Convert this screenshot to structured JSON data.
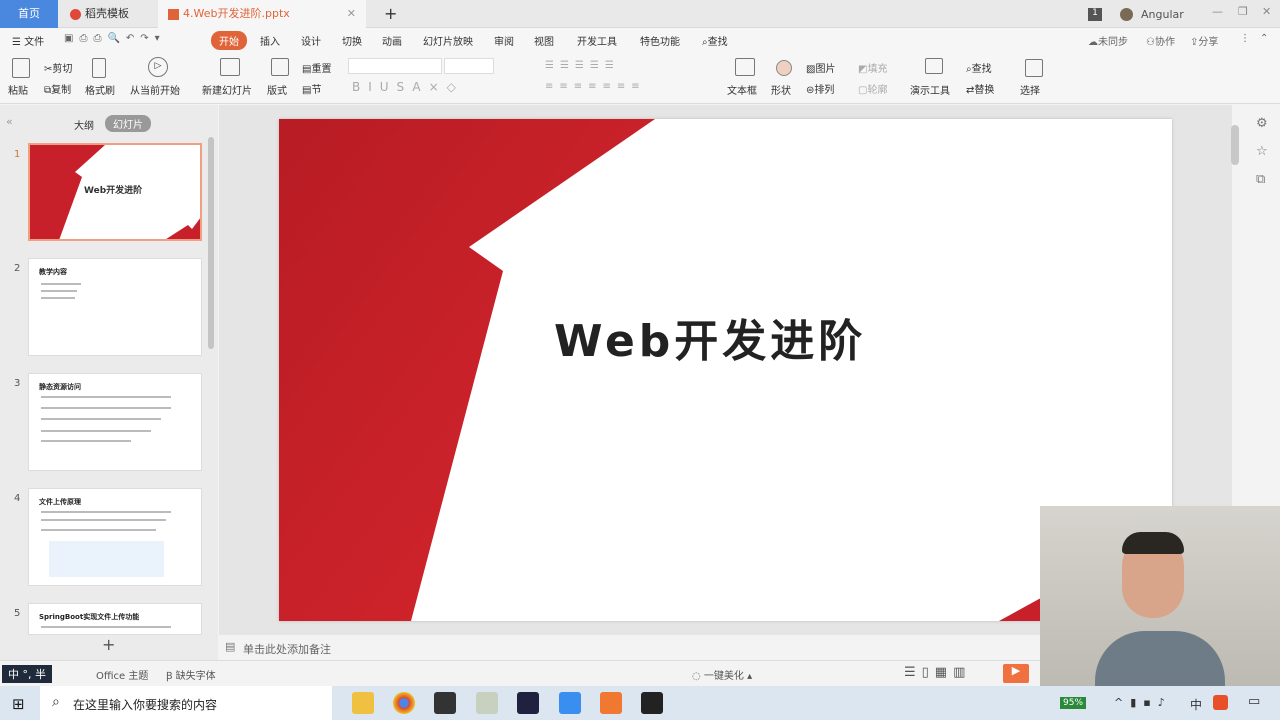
{
  "tabs": [
    {
      "label": "首页"
    },
    {
      "label": "稻壳模板"
    },
    {
      "label": "4.Web开发进阶.pptx"
    }
  ],
  "window": {
    "badge": "1",
    "user": "Angular"
  },
  "menu": {
    "file": "文件",
    "items": [
      "开始",
      "插入",
      "设计",
      "切换",
      "动画",
      "幻灯片放映",
      "审阅",
      "视图",
      "开发工具",
      "特色功能"
    ],
    "search": "查找",
    "sync": "未同步",
    "collab": "协作",
    "share": "分享"
  },
  "ribbon": {
    "paste": "粘贴",
    "cut": "剪切",
    "copy": "复制",
    "format_painter": "格式刷",
    "play_from_current": "从当前开始",
    "new_slide": "新建幻灯片",
    "layout": "版式",
    "reset": "重置",
    "section": "节",
    "textbox": "文本框",
    "shape": "形状",
    "picture": "图片",
    "fill": "填充",
    "arrange": "排列",
    "outline": "轮廓",
    "present_tools": "演示工具",
    "find": "查找",
    "replace": "替换",
    "select": "选择"
  },
  "left_panel": {
    "tab_outline": "大纲",
    "tab_slides": "幻灯片"
  },
  "slides": [
    {
      "num": "1",
      "title": "Web开发进阶"
    },
    {
      "num": "2",
      "title": "教学内容"
    },
    {
      "num": "3",
      "title": "静态资源访问"
    },
    {
      "num": "4",
      "title": "文件上传原理"
    },
    {
      "num": "5",
      "title": "SpringBoot实现文件上传功能"
    }
  ],
  "main_slide": {
    "title": "Web开发进阶"
  },
  "notes": {
    "placeholder": "单击此处添加备注"
  },
  "status": {
    "theme": "Office 主题",
    "missing_fonts": "缺失字体",
    "beautify": "一键美化",
    "ime": "中 °, 半"
  },
  "taskbar": {
    "search": "在这里输入你要搜索的内容",
    "battery": "95%",
    "ime": "中"
  },
  "colors": {
    "accent": "#e0643a",
    "slide_red": "#c8202a"
  }
}
